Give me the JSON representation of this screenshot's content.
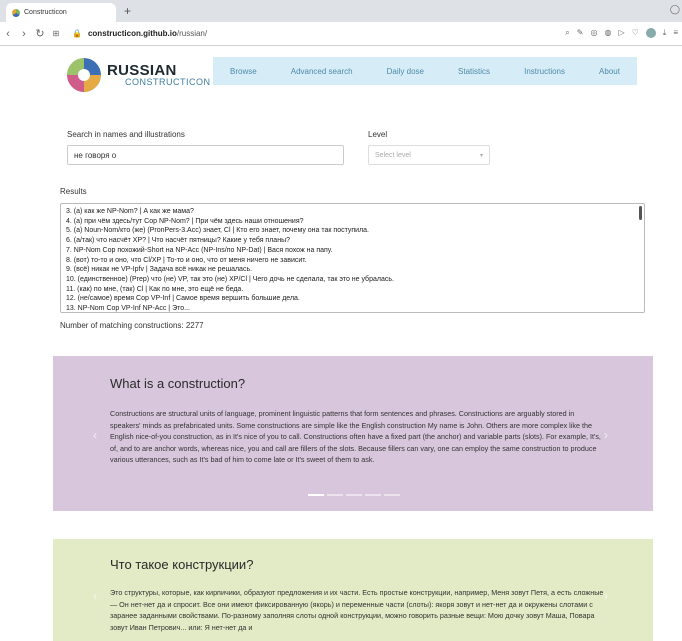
{
  "browser": {
    "tab_title": "Constructicon",
    "new_tab": "+",
    "url_host": "constructicon.github.io",
    "url_path": "/russian/"
  },
  "site": {
    "logo_title": "RUSSIAN",
    "logo_sub": "CONSTRUCTICON",
    "nav": [
      "Browse",
      "Advanced search",
      "Daily dose",
      "Statistics",
      "Instructions",
      "About"
    ]
  },
  "search": {
    "label": "Search in names and illustrations",
    "value": "не говоря о"
  },
  "level": {
    "label": "Level",
    "placeholder": "Select level"
  },
  "results": {
    "label": "Results",
    "items": [
      "3. (а) как же NP-Nom? | А как же мама?",
      "4. (а) при чём здесь/тут Cop NP-Nom? | При чём здесь наши отношения?",
      "5. (а) Noun-Nom/кто (же) (PronPers-3.Acc) знает, Cl | Кто его знает, почему она так поступила.",
      "6. (а/так) что насчёт XP? | Что насчёт пятницы? Какие у тебя планы?",
      "7. NP-Nom Cop похожий-Short на NP-Acc (NP-Ins/по NP-Dat) | Вася похож на папу.",
      "8. (вот) то-то и оно, что Cl/XP | То-то и оно, что от меня ничего не зависит.",
      "9. (всё) никак не VP-Ipfv | Задача всё никак не решалась.",
      "10. (единственное) (Prep) что (не) VP, так это (не) XP/Cl | Чего дочь не сделала, так это не убралась.",
      "11. (как) по мне, (так) Cl | Как по мне, это ещё не беда.",
      "12. (не/самое) время Cop VP-Inf | Самое время вершить большие дела.",
      "13. NP-Nom Cop VP-Inf NP-Acc | Это..."
    ],
    "match_count": "Number of matching constructions: 2277"
  },
  "panel_en": {
    "title": "What is a construction?",
    "body": "Constructions are structural units of language, prominent linguistic patterns that form sentences and phrases. Constructions are arguably stored in speakers' minds as prefabricated units. Some constructions are simple like the English construction My name is John. Others are more complex like the English nice-of-you construction, as in It's nice of you to call. Constructions often have a fixed part (the anchor) and variable parts (slots). For example, It's, of, and to are anchor words, whereas nice, you and call are fillers of the slots. Because fillers can vary, one can employ the same construction to produce various utterances, such as It's bad of him to come late or It's sweet of them to ask.",
    "color": "#d8c7dc"
  },
  "panel_ru": {
    "title": "Что такое конструкции?",
    "body": "Это структуры, которые, как кирпичики, образуют предложения и их части. Есть простые конструкции, например, Меня зовут Петя, а есть сложные — Он нет-нет да и спросит. Все они имеют фиксированную (якорь) и переменные части (слоты): якоря зовут и нет-нет да и окружены слотами с заранее заданными свойствами. По-разному заполняя слоты одной конструкции, можно говорить разные вещи: Мою дочку зовут Маша, Повара зовут Иван Петрович... или: Я нет-нет да и",
    "color": "#e2ebc5"
  },
  "colors": {
    "nav_bg": "#d6edf7",
    "nav_link": "#4f8aa8",
    "logo_sub": "#3a7fa3"
  }
}
